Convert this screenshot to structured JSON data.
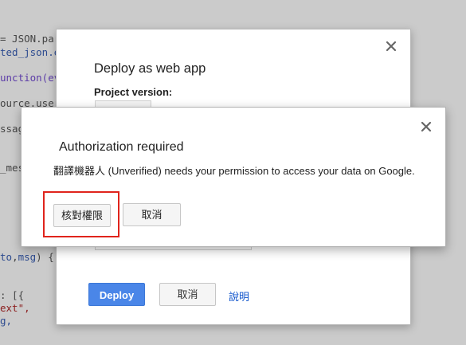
{
  "code_editor": {
    "lines": [
      [
        {
          "t": "= JSON.par",
          "c": "c-default"
        }
      ],
      [
        {
          "t": "ted_json.e",
          "c": "c-var"
        }
      ],
      [
        {
          "t": "unction(ev",
          "c": "c-keyword"
        }
      ],
      [
        {
          "t": "ource.user",
          "c": "c-default"
        }
      ],
      [
        {
          "t": "ssag",
          "c": "c-default"
        }
      ],
      [
        {
          "t": "_mes",
          "c": "c-default"
        }
      ],
      [
        {
          "t": "to",
          "c": "c-var"
        },
        {
          "t": ",",
          "c": "c-default"
        },
        {
          "t": "msg",
          "c": "c-var"
        },
        {
          "t": ") {",
          "c": "c-default"
        }
      ],
      [
        {
          "t": ": [{",
          "c": "c-default"
        }
      ],
      [
        {
          "t": "ext\",",
          "c": "c-string"
        }
      ],
      [
        {
          "t": "g,",
          "c": "c-var"
        }
      ]
    ]
  },
  "deploy_dialog": {
    "title": "Deploy as web app",
    "project_version_label": "Project version:",
    "deploy_button": "Deploy",
    "cancel_button": "取消",
    "help_link": "說明"
  },
  "auth_dialog": {
    "title": "Authorization required",
    "message": "翻譯機器人 (Unverified) needs your permission to access your data on Google.",
    "grant_button": "核對權限",
    "cancel_button": "取消"
  },
  "colors": {
    "deploy_button_bg": "#4a86e8",
    "highlight_border": "#e0241c",
    "link": "#1155cc"
  }
}
